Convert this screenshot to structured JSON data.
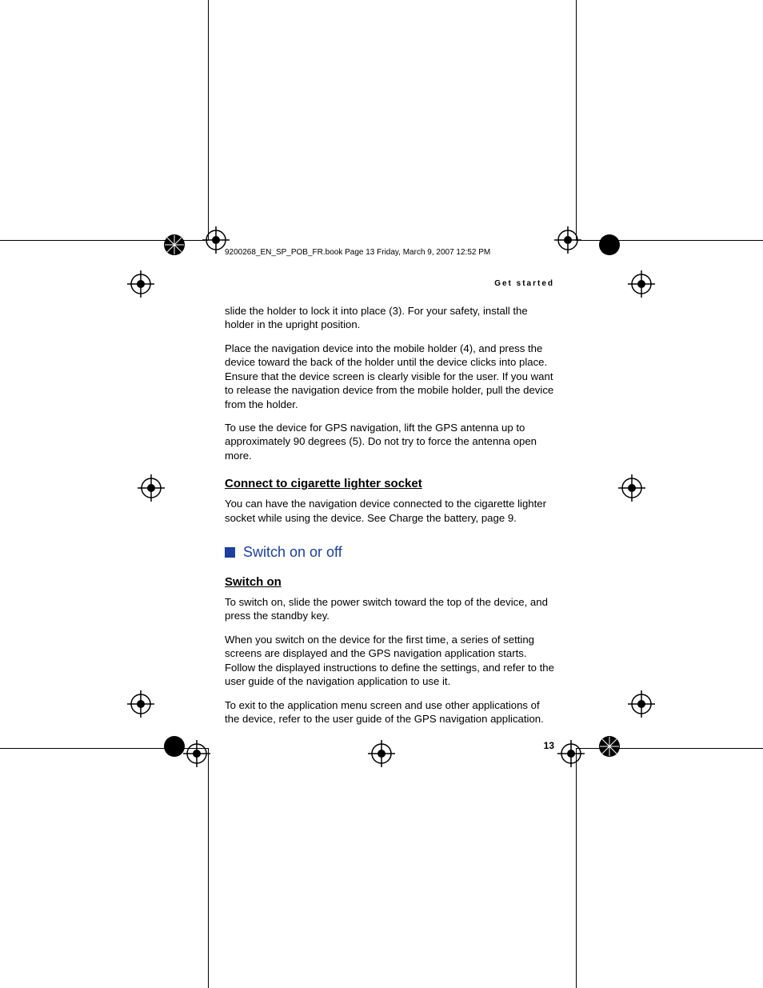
{
  "header": "9200268_EN_SP_POB_FR.book  Page 13  Friday, March 9, 2007  12:52 PM",
  "running_head": "Get started",
  "p1": "slide the holder to lock it into place (3). For your safety, install the holder in the upright position.",
  "p2": "Place the navigation device into the mobile holder (4), and press the device toward the back of the holder until the device clicks into place. Ensure that the device screen is clearly visible for the user. If you want to release the navigation device from the mobile holder, pull the device from the holder.",
  "p3": "To use the device for GPS navigation, lift the GPS antenna up to approximately 90 degrees (5). Do not try to force the antenna open more.",
  "h_sub1": "Connect to cigarette lighter socket",
  "p4": "You can have the navigation device connected to the cigarette lighter socket while using the device. See Charge the battery, page 9.",
  "h_section": "Switch on or off",
  "h_sub2": "Switch on",
  "p5": "To switch on, slide the power switch toward the top of the device, and press the standby key.",
  "p6": "When you switch on the device for the first time, a series of setting screens are displayed and the GPS navigation application starts. Follow the displayed instructions to define the settings, and refer to the user guide of the navigation application to use it.",
  "p7": "To exit to the application menu screen and use other applications of the device, refer to the user guide of the GPS navigation application.",
  "page_number": "13"
}
